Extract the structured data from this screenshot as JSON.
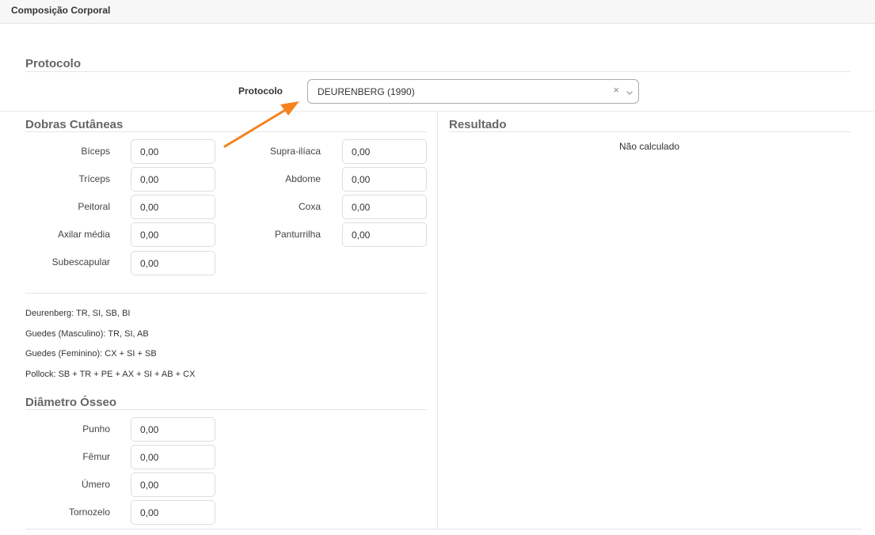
{
  "header": {
    "title": "Composição Corporal"
  },
  "protocolo": {
    "section_title": "Protocolo",
    "label": "Protocolo",
    "selected": "DEURENBERG (1990)",
    "clear_glyph": "×"
  },
  "dobras": {
    "section_title": "Dobras Cutâneas",
    "left": [
      {
        "label": "Bíceps",
        "value": "0,00"
      },
      {
        "label": "Tríceps",
        "value": "0,00"
      },
      {
        "label": "Peitoral",
        "value": "0,00"
      },
      {
        "label": "Axilar média",
        "value": "0,00"
      },
      {
        "label": "Subescapular",
        "value": "0,00"
      }
    ],
    "right": [
      {
        "label": "Supra-ilíaca",
        "value": "0,00"
      },
      {
        "label": "Abdome",
        "value": "0,00"
      },
      {
        "label": "Coxa",
        "value": "0,00"
      },
      {
        "label": "Panturrilha",
        "value": "0,00"
      }
    ]
  },
  "notes": [
    "Deurenberg: TR, SI, SB, BI",
    "Guedes (Masculino): TR, SI, AB",
    "Guedes (Feminino): CX + SI + SB",
    "Pollock: SB + TR + PE + AX + SI + AB + CX"
  ],
  "diametro": {
    "section_title": "Diâmetro Ósseo",
    "items": [
      {
        "label": "Punho",
        "value": "0,00"
      },
      {
        "label": "Fêmur",
        "value": "0,00"
      },
      {
        "label": "Úmero",
        "value": "0,00"
      },
      {
        "label": "Tornozelo",
        "value": "0,00"
      }
    ]
  },
  "resultado": {
    "section_title": "Resultado",
    "text": "Não calculado"
  },
  "colors": {
    "arrow": "#f5821f"
  },
  "icons": {
    "select_chevron": "chevron-down-icon",
    "annotation": "arrow-annotation"
  }
}
